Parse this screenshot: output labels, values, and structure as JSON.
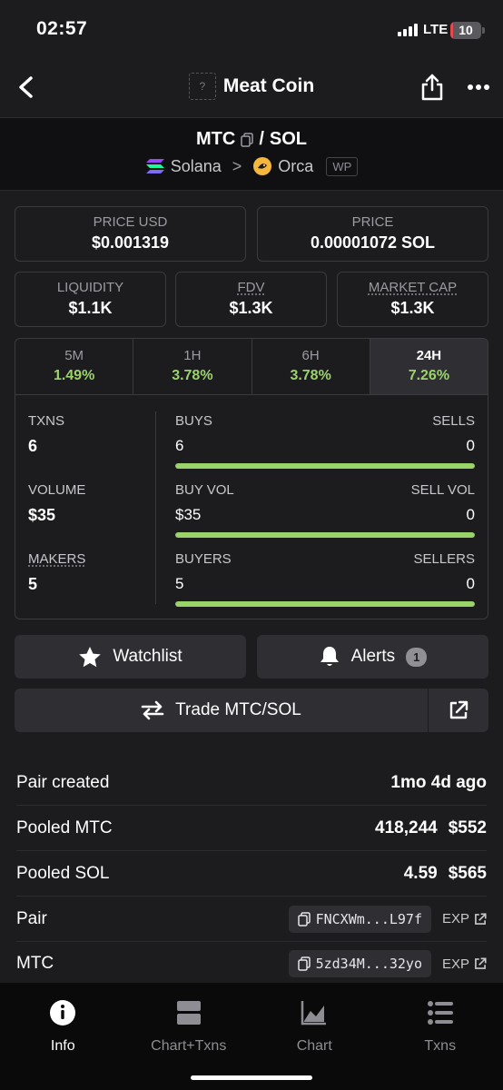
{
  "status": {
    "time": "02:57",
    "network": "LTE",
    "battery": "10"
  },
  "nav": {
    "title": "Meat Coin",
    "coin_placeholder": "?"
  },
  "pair": {
    "base": "MTC",
    "quote": "SOL",
    "separator": "/",
    "chain": "Solana",
    "dex": "Orca",
    "chevron": ">",
    "wp": "WP"
  },
  "prices": {
    "usd_label": "PRICE USD",
    "usd_value": "$0.001319",
    "native_label": "PRICE",
    "native_value": "0.00001072 SOL"
  },
  "metrics": [
    {
      "label": "LIQUIDITY",
      "value": "$1.1K"
    },
    {
      "label": "FDV",
      "value": "$1.3K"
    },
    {
      "label": "MARKET CAP",
      "value": "$1.3K"
    }
  ],
  "timeframes": [
    {
      "label": "5M",
      "change": "1.49%"
    },
    {
      "label": "1H",
      "change": "3.78%"
    },
    {
      "label": "6H",
      "change": "3.78%"
    },
    {
      "label": "24H",
      "change": "7.26%",
      "active": true
    }
  ],
  "stats": {
    "txns": {
      "label": "TXNS",
      "value": "6",
      "left_label": "BUYS",
      "left_value": "6",
      "right_label": "SELLS",
      "right_value": "0",
      "ratio": 1.0
    },
    "volume": {
      "label": "VOLUME",
      "value": "$35",
      "left_label": "BUY VOL",
      "left_value": "$35",
      "right_label": "SELL VOL",
      "right_value": "0",
      "ratio": 1.0
    },
    "makers": {
      "label": "MAKERS",
      "value": "5",
      "left_label": "BUYERS",
      "left_value": "5",
      "right_label": "SELLERS",
      "right_value": "0",
      "ratio": 1.0
    }
  },
  "actions": {
    "watchlist": "Watchlist",
    "alerts": "Alerts",
    "alerts_count": "1",
    "trade": "Trade MTC/SOL"
  },
  "info": {
    "pair_created_label": "Pair created",
    "pair_created_value": "1mo 4d ago",
    "pooled_base_label": "Pooled MTC",
    "pooled_base_amount": "418,244",
    "pooled_base_usd": "$552",
    "pooled_quote_label": "Pooled SOL",
    "pooled_quote_amount": "4.59",
    "pooled_quote_usd": "$565",
    "pair_label": "Pair",
    "pair_address": "FNCXWm...L97f",
    "pair_exp": "EXP",
    "token_label": "MTC",
    "token_address": "5zd34M...32yo",
    "token_exp": "EXP"
  },
  "tabbar": [
    {
      "label": "Info",
      "icon": "info-icon",
      "active": true
    },
    {
      "label": "Chart+Txns",
      "icon": "chart-txns-icon"
    },
    {
      "label": "Chart",
      "icon": "chart-icon"
    },
    {
      "label": "Txns",
      "icon": "list-icon"
    }
  ],
  "colors": {
    "accent_green": "#9bd36b",
    "background": "#1c1c1f",
    "panel": "#2e2e33",
    "border": "#3a3a3f"
  }
}
